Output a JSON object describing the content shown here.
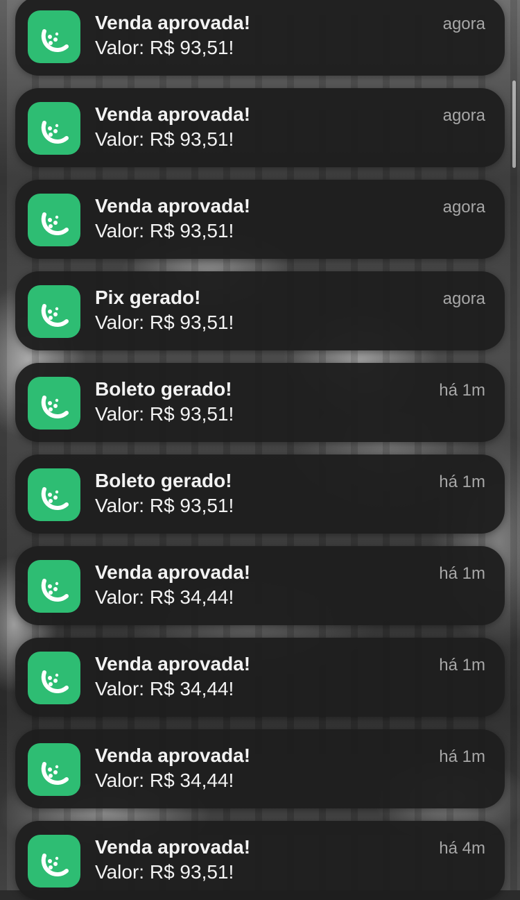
{
  "notifications": [
    {
      "title": "Venda aprovada!",
      "body": "Valor: R$ 93,51!",
      "time": "agora",
      "icon": "lime-slice-icon"
    },
    {
      "title": "Venda aprovada!",
      "body": "Valor: R$ 93,51!",
      "time": "agora",
      "icon": "lime-slice-icon"
    },
    {
      "title": "Venda aprovada!",
      "body": "Valor: R$ 93,51!",
      "time": "agora",
      "icon": "lime-slice-icon"
    },
    {
      "title": "Pix gerado!",
      "body": "Valor: R$ 93,51!",
      "time": "agora",
      "icon": "lime-slice-icon"
    },
    {
      "title": "Boleto gerado!",
      "body": "Valor: R$ 93,51!",
      "time": "há 1m",
      "icon": "lime-slice-icon"
    },
    {
      "title": "Boleto gerado!",
      "body": "Valor: R$ 93,51!",
      "time": "há 1m",
      "icon": "lime-slice-icon"
    },
    {
      "title": "Venda aprovada!",
      "body": "Valor: R$ 34,44!",
      "time": "há 1m",
      "icon": "lime-slice-icon"
    },
    {
      "title": "Venda aprovada!",
      "body": "Valor: R$ 34,44!",
      "time": "há 1m",
      "icon": "lime-slice-icon"
    },
    {
      "title": "Venda aprovada!",
      "body": "Valor: R$ 34,44!",
      "time": "há 1m",
      "icon": "lime-slice-icon"
    },
    {
      "title": "Venda aprovada!",
      "body": "Valor: R$ 93,51!",
      "time": "há 4m",
      "icon": "lime-slice-icon"
    }
  ],
  "colors": {
    "app_icon": "#2ebd73",
    "card_background": "#1e1e1e",
    "text_primary": "#f2f2f2",
    "text_secondary": "#a7a7a7"
  }
}
